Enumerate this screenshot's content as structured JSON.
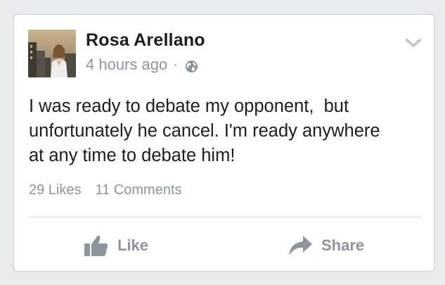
{
  "post": {
    "author_name": "Rosa Arellano",
    "timestamp": "4 hours ago",
    "separator": "·",
    "privacy_icon": "globe-icon",
    "body": "I was ready to debate my opponent,  but\nunfortunately he cancel. I'm ready anywhere\nat any time to debate him!",
    "likes_count": "29 Likes",
    "comments_count": "11 Comments"
  },
  "actions": {
    "like_label": "Like",
    "share_label": "Share",
    "like_icon": "thumbs-up-icon",
    "share_icon": "share-arrow-icon",
    "menu_icon": "chevron-down-icon"
  },
  "colors": {
    "background": "#e9eaee",
    "card": "#ffffff",
    "text_primary": "#1d1d1f",
    "text_secondary": "#8d949e",
    "icon_gray": "#8d949e"
  }
}
